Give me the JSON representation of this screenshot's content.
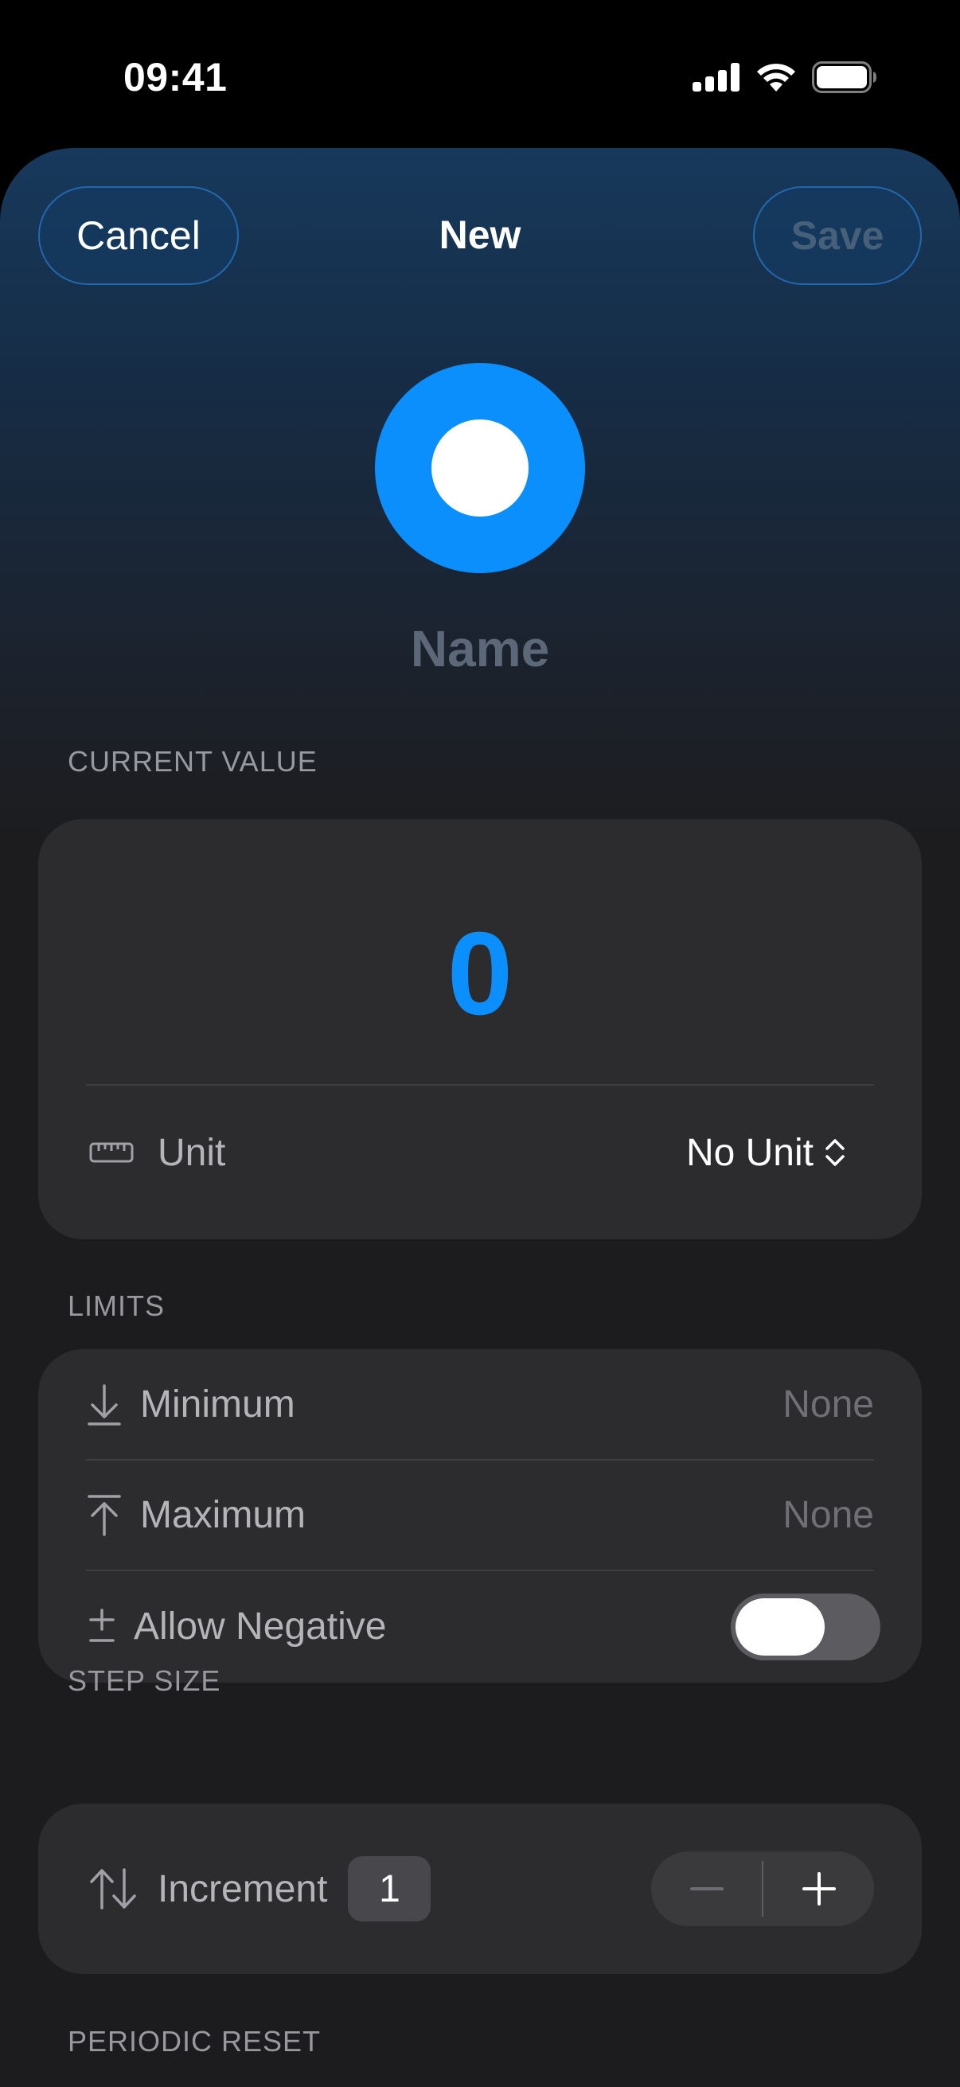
{
  "status_bar": {
    "time": "09:41"
  },
  "header": {
    "cancel_label": "Cancel",
    "title": "New",
    "save_label": "Save"
  },
  "avatar": {
    "color": "#0a8ffc"
  },
  "name_placeholder": "Name",
  "current_value": {
    "section_title": "CURRENT VALUE",
    "value": "0",
    "unit_label": "Unit",
    "unit_value": "No Unit"
  },
  "limits": {
    "section_title": "LIMITS",
    "minimum_label": "Minimum",
    "minimum_value": "None",
    "maximum_label": "Maximum",
    "maximum_value": "None",
    "allow_negative_label": "Allow Negative",
    "allow_negative_on": false
  },
  "step_size": {
    "section_title": "STEP SIZE",
    "increment_label": "Increment",
    "increment_value": "1"
  },
  "periodic_reset": {
    "section_title": "PERIODIC RESET"
  },
  "colors": {
    "accent": "#0a8ffc",
    "card": "#2c2c2e",
    "background": "#1c1c1e"
  }
}
